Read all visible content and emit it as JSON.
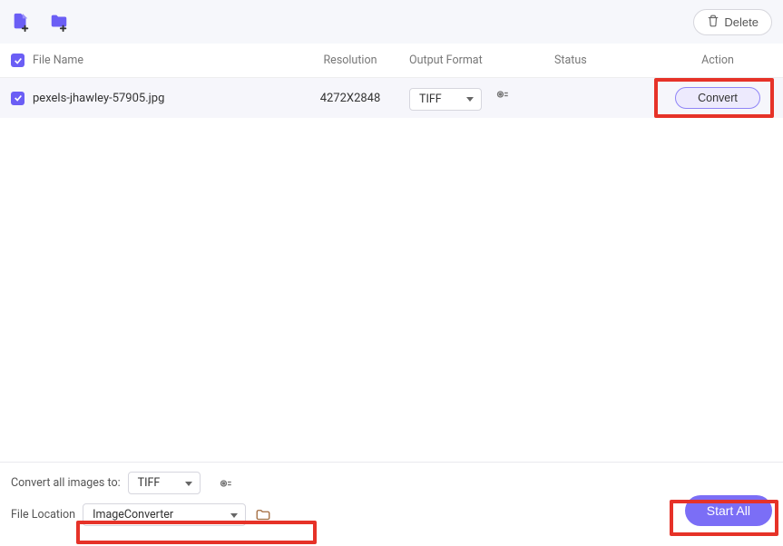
{
  "toolbar": {
    "delete_label": "Delete"
  },
  "headers": {
    "filename": "File Name",
    "resolution": "Resolution",
    "output_format": "Output Format",
    "status": "Status",
    "action": "Action"
  },
  "rows": [
    {
      "filename": "pexels-jhawley-57905.jpg",
      "resolution": "4272X2848",
      "format": "TIFF",
      "convert_label": "Convert"
    }
  ],
  "bottom": {
    "convert_all_label": "Convert all images to:",
    "convert_all_format": "TIFF",
    "file_location_label": "File Location",
    "file_location_value": "ImageConverter",
    "start_all_label": "Start  All"
  }
}
